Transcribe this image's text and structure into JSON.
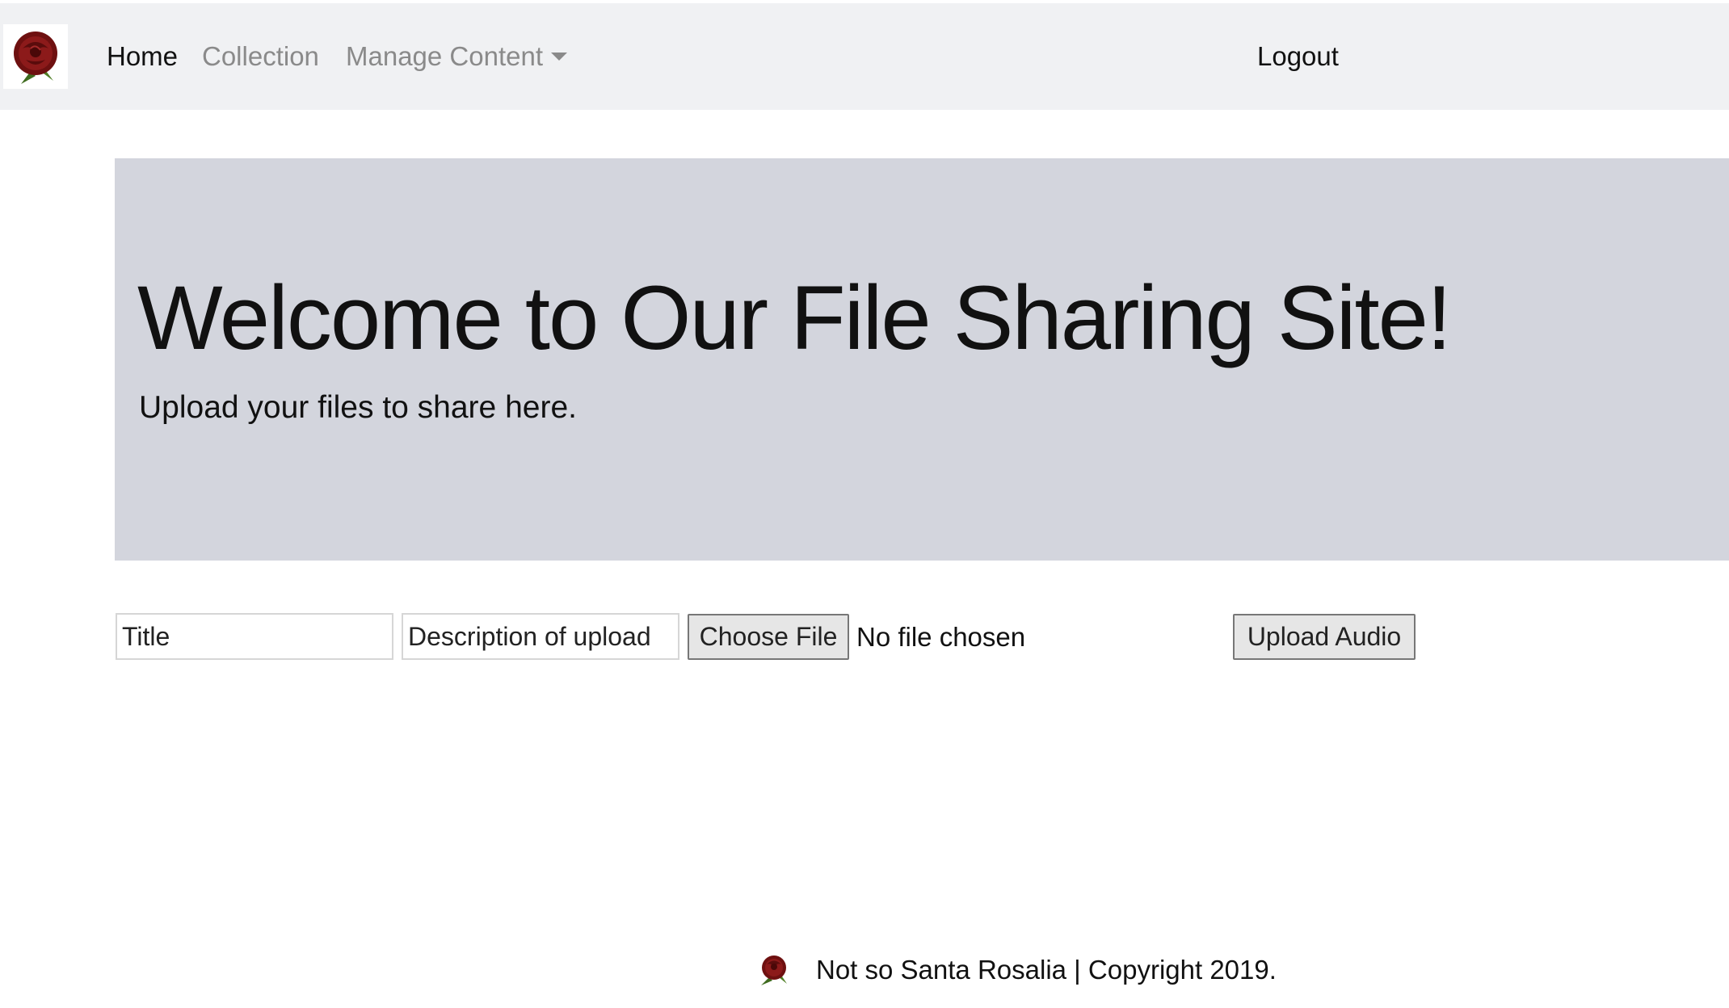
{
  "navbar": {
    "brand_icon": "rose-logo-icon",
    "links": {
      "home": "Home",
      "collection": "Collection",
      "manage_content": "Manage Content"
    },
    "logout": "Logout"
  },
  "jumbotron": {
    "title": "Welcome to Our File Sharing Site!",
    "lead": "Upload your files to share here."
  },
  "upload_form": {
    "title_placeholder": "Title",
    "description_placeholder": "Description of upload",
    "choose_file_label": "Choose File",
    "file_status": "No file chosen",
    "submit_label": "Upload Audio"
  },
  "footer": {
    "logo_icon": "rose-logo-icon",
    "text": "Not so Santa Rosalia | Copyright 2019."
  },
  "colors": {
    "navbar_bg": "#f0f1f3",
    "jumbotron_bg": "#d3d5dd",
    "rose": "#7a1414",
    "leaf": "#3e6b1e"
  }
}
